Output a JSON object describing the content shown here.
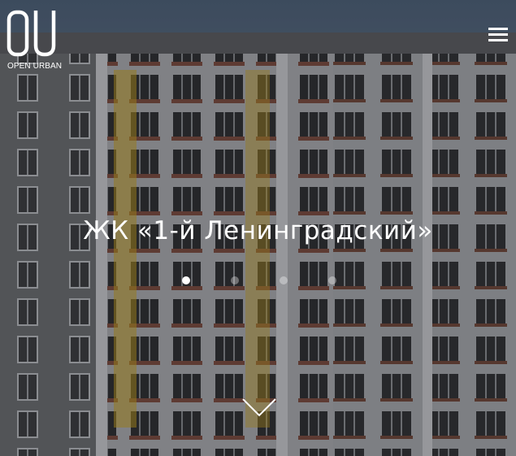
{
  "brand": {
    "logo_mark": "OU",
    "logo_text": "OPEN URBAN"
  },
  "header": {
    "menu_icon": "hamburger-menu-icon"
  },
  "hero": {
    "title": "ЖК «1-й Ленинградский»",
    "slides_total": 4,
    "active_slide": 1,
    "scroll_icon": "chevron-down-icon"
  },
  "colors": {
    "text": "#ffffff",
    "facade": "#8e9094",
    "brick": "#7a4a3e",
    "accent_yellow": "#c9a21e"
  }
}
